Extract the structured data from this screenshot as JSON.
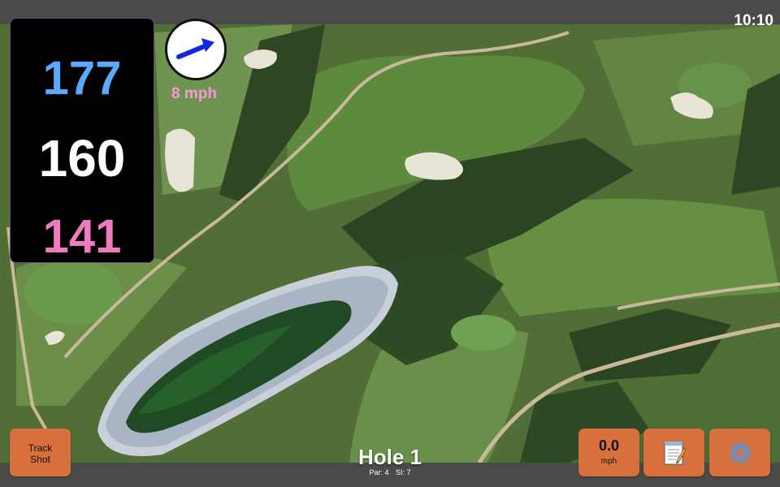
{
  "status": {
    "time": "10:10"
  },
  "distances": {
    "back": "177",
    "center": "160",
    "front": "141"
  },
  "wind": {
    "speed": "8 mph",
    "arrow_icon": "arrow-right-icon"
  },
  "hole": {
    "title": "Hole 1",
    "par": "Par: 4",
    "si": "SI: 7"
  },
  "buttons": {
    "track_shot": "Track\nShot",
    "speed_value": "0.0",
    "speed_unit": "mph",
    "notes_icon": "notepad-icon",
    "settings_icon": "gear-icon"
  },
  "colors": {
    "back": "#5ba8ff",
    "center": "#ffffff",
    "front": "#f07ac0",
    "wind_text": "#f59ad6",
    "button": "#d8703e"
  }
}
